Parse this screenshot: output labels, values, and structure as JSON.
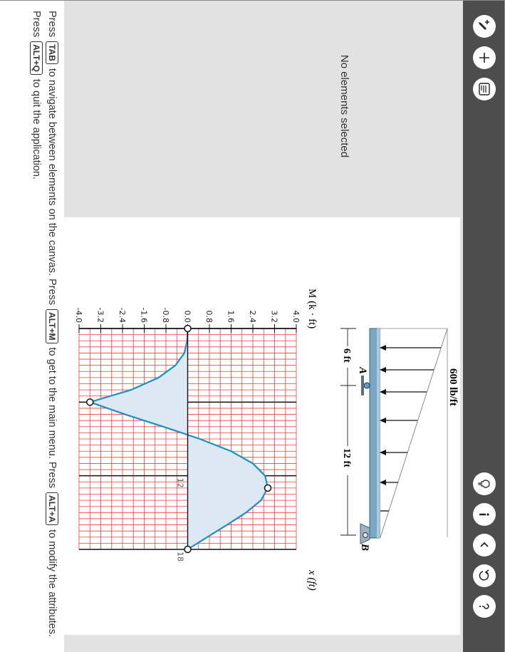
{
  "inspector": {
    "empty_message": "No elements selected"
  },
  "toolbar": {
    "left_tools": [
      "pencil-plus-icon",
      "plus-icon",
      "list-panel-icon"
    ],
    "right_tools": [
      "lightbulb-icon",
      "info-icon",
      "chevron-left-icon",
      "undo-icon",
      "help-icon"
    ]
  },
  "figure": {
    "load_label": "600 lb/ft",
    "support_a": "A",
    "support_b": "B",
    "dim_left": "6 ft",
    "dim_right": "12 ft"
  },
  "chart_data": {
    "type": "line",
    "ylabel": "M (k · ft)",
    "xlabel": "x (ft)",
    "xlim": [
      0,
      18
    ],
    "ylim": [
      -4.0,
      4.0
    ],
    "y_ticks": [
      "4.0",
      "3.2",
      "2.4",
      "1.6",
      "0.8",
      "0.0",
      "-0.8",
      "-1.6",
      "-2.4",
      "-3.2",
      "-4.0"
    ],
    "x_tick_labels": [
      {
        "x": 12,
        "label": "12"
      },
      {
        "x": 18,
        "label": "18"
      }
    ],
    "grid": true,
    "series": [
      {
        "x": [
          0,
          1,
          2,
          3,
          4,
          5,
          6,
          7,
          8,
          9,
          10,
          11,
          12,
          13,
          14,
          15,
          16,
          17,
          18
        ],
        "values": [
          0,
          -0.02,
          -0.12,
          -0.45,
          -1.07,
          -2.08,
          -3.6,
          -2.3,
          -0.9,
          0.45,
          1.6,
          2.4,
          2.85,
          2.95,
          2.7,
          2.15,
          1.45,
          0.72,
          0
        ]
      }
    ],
    "control_points": [
      {
        "x": 0,
        "y": 0
      },
      {
        "x": 6,
        "y": -3.6
      },
      {
        "x": 13,
        "y": 2.95
      },
      {
        "x": 18,
        "y": 0
      }
    ]
  },
  "instructions": {
    "p1": "Press",
    "k_tab": "TAB",
    "p2": "to navigate between elements on the canvas. Press",
    "k_altm": "ALT+M",
    "p3": "to get to the main menu. Press",
    "k_alta": "ALT+A",
    "p4": "to modify the attributes. Press",
    "k_altq": "ALT+Q",
    "p5": "to quit the application."
  }
}
